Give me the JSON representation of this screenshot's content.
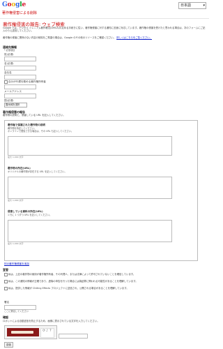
{
  "brand": {
    "logo_text": "Google"
  },
  "topbar": {
    "language": "日本語",
    "breadcrumb": "著作権侵害による削除"
  },
  "page": {
    "title": "著作権侵害の報告: ウェブ検索",
    "intro_1": "Google では、デジタル ミレニアム著作権法(DMCA)の定める手続きに従い、著作権侵害に対する通知に迅速に対応しています。著作権の侵害を受けたと思われる場合は、次のフォームにご記入のうえ送信してください。",
    "intro_2": "著作権の侵害に関係のない内容の削除をご希望の場合は、Google のその他のリソースをご確認ください。",
    "notice_link": "詳しくはこちらをご覧ください。"
  },
  "contact": {
    "section_title": "連絡先情報",
    "required_note": "* 必須項目",
    "last_name_label": "姓(必須)",
    "first_name_label": "名(必須)",
    "company_label": "会社名",
    "check_label": "自分が代理を務める著作権所有者",
    "email_label": "メールアドレス",
    "country_label": "国(必須)",
    "country_value": "国/地域を選択"
  },
  "infringement": {
    "section_title": "著作権侵害の報告",
    "section_desc": "著作物の説明と、侵害している URL を記入してください。",
    "box_title": "著作権で保護された著作物の説明",
    "box_desc_1": "著作物を特定してください。",
    "box_desc_2": "オンラインで閲覧できる場合は、その URL も記入してください。",
    "count_1": "最大 1,000 文字",
    "source_title": "著作物の所在(URL)",
    "source_desc": "オリジナルの著作物が存在する URL を記入してください。",
    "count_2": "最大 1,000 文字",
    "infringing_title": "侵害している資料の所在(URL)",
    "infringing_desc": "1 行に 1 つずつ URL を記入してください。",
    "count_3": "最大 1,000 文字",
    "add_link": "別の著作権侵害を追加"
  },
  "declaration": {
    "section_title": "宣誓",
    "p1": "私は、上記の著作物の使用が著作権所有者、その代理人、または法律によって許可されていないことを確信しています。",
    "p2": "私は、この通知の情報が正確であり、虚偽の申告を行った場合には偽証罪に問われる可能性があることを理解しています。",
    "p3": "私は、提供した情報が Chilling Effects プロジェクトに送信され、公開される場合があることを理解しています。",
    "signature_label": "署名",
    "sign_here": "ここに署名してください"
  },
  "captcha": {
    "section_title": "確認",
    "desc": "ロボットによる自動送信を防止するため、画像に表示されている文字を入力してください。"
  },
  "footer": {
    "submit_label": "送信"
  }
}
